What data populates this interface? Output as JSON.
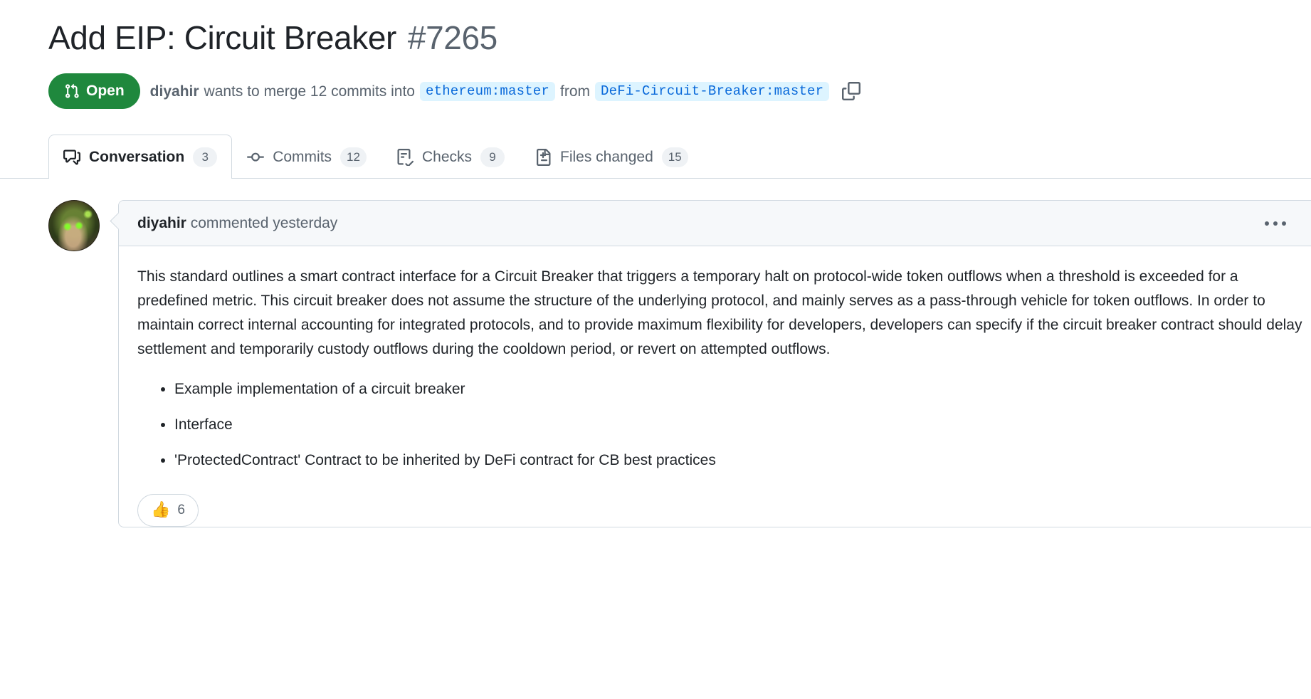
{
  "header": {
    "title": "Add EIP: Circuit Breaker",
    "number": "#7265"
  },
  "status": {
    "state_label": "Open",
    "state_color": "#1f883d",
    "author": "diyahir",
    "merge_text_before": "wants to merge 12 commits into",
    "base_branch": "ethereum:master",
    "from_text": "from",
    "head_branch": "DeFi-Circuit-Breaker:master",
    "copy_icon": "copy-icon"
  },
  "tabs": [
    {
      "label": "Conversation",
      "count": "3",
      "icon": "comment-discussion-icon",
      "active": true
    },
    {
      "label": "Commits",
      "count": "12",
      "icon": "git-commit-icon",
      "active": false
    },
    {
      "label": "Checks",
      "count": "9",
      "icon": "checklist-icon",
      "active": false
    },
    {
      "label": "Files changed",
      "count": "15",
      "icon": "file-diff-icon",
      "active": false
    }
  ],
  "comment": {
    "author": "diyahir",
    "action_time": "commented yesterday",
    "menu_icon": "kebab-horizontal-icon",
    "paragraph": "This standard outlines a smart contract interface for a Circuit Breaker that triggers a temporary halt on protocol-wide token outflows when a threshold is exceeded for a predefined metric. This circuit breaker does not assume the structure of the underlying protocol, and mainly serves as a pass-through vehicle for token outflows. In order to maintain correct internal accounting for integrated protocols, and to provide maximum flexibility for developers, developers can specify if the circuit breaker contract should delay settlement and temporarily custody outflows during the cooldown period, or revert on attempted outflows.",
    "bullets": [
      "Example implementation of a circuit breaker",
      "Interface",
      "'ProtectedContract' Contract to be inherited by DeFi contract for CB best practices"
    ],
    "reaction": {
      "emoji": "👍",
      "count": "6"
    }
  }
}
